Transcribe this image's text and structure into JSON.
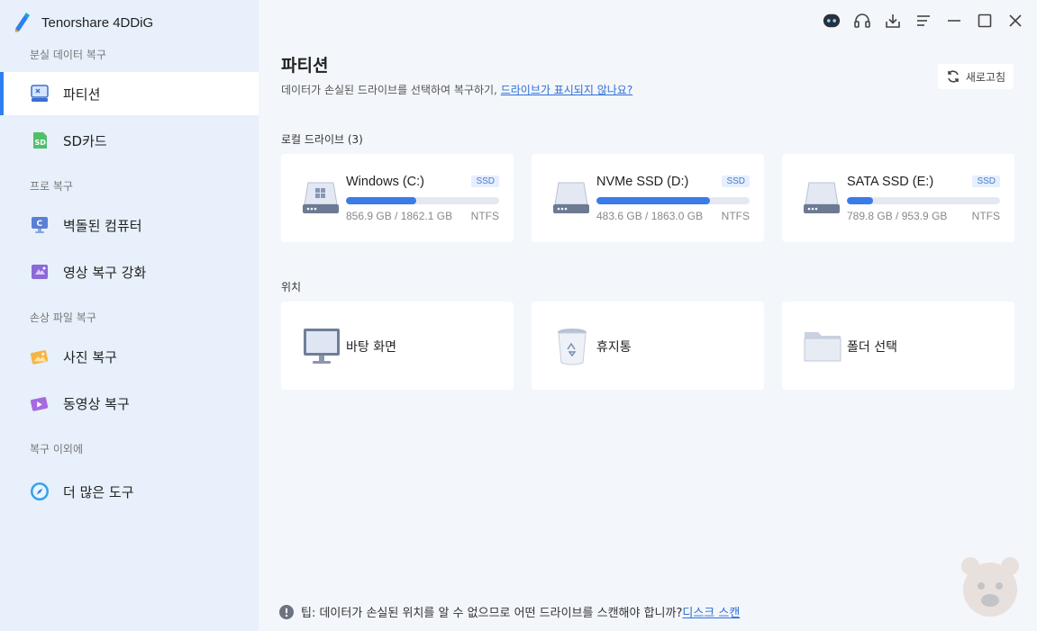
{
  "app": {
    "title": "Tenorshare 4DDiG"
  },
  "sidebar": {
    "sections": [
      {
        "label": "분실 데이터 복구"
      },
      {
        "label": "프로 복구"
      },
      {
        "label": "손상 파일 복구"
      },
      {
        "label": "복구 이외에"
      }
    ],
    "items": [
      {
        "label": "파티션",
        "icon": "partition-icon",
        "active": true
      },
      {
        "label": "SD카드",
        "icon": "sd-card-icon"
      },
      {
        "label": "벽돌된 컴퓨터",
        "icon": "crashed-computer-icon"
      },
      {
        "label": "영상 복구 강화",
        "icon": "video-enhance-icon"
      },
      {
        "label": "사진 복구",
        "icon": "photo-icon"
      },
      {
        "label": "동영상 복구",
        "icon": "video-icon"
      },
      {
        "label": "더 많은 도구",
        "icon": "compass-icon"
      }
    ]
  },
  "main": {
    "title": "파티션",
    "subtitle": "데이터가 손실된 드라이브를 선택하여 복구하기, ",
    "subtitle_link": "드라이브가 표시되지 않나요?",
    "refresh_label": "새로고침",
    "local_drives_label": "로컬 드라이브 (3)",
    "drives": [
      {
        "name": "Windows (C:)",
        "badge": "SSD",
        "size": "856.9 GB / 1862.1 GB",
        "fs": "NTFS",
        "used_fraction": 0.46
      },
      {
        "name": "NVMe SSD (D:)",
        "badge": "SSD",
        "size": "483.6 GB / 1863.0 GB",
        "fs": "NTFS",
        "used_fraction": 0.74
      },
      {
        "name": "SATA SSD (E:)",
        "badge": "SSD",
        "size": "789.8 GB / 953.9 GB",
        "fs": "NTFS",
        "used_fraction": 0.17
      }
    ],
    "locations_label": "위치",
    "locations": [
      {
        "name": "바탕 화면",
        "icon": "desktop-icon"
      },
      {
        "name": "휴지통",
        "icon": "recycle-bin-icon"
      },
      {
        "name": "폴더 선택",
        "icon": "folder-icon"
      }
    ],
    "tip": "팁: 데이터가 손실된 위치를 알 수 없으므로 어떤 드라이브를 스캔해야 합니까?",
    "tip_link": "디스크 스캔"
  },
  "colors": {
    "accent": "#2f7ff0",
    "bar": "#3a7be8",
    "sidebar_bg": "#e7f0fb"
  }
}
